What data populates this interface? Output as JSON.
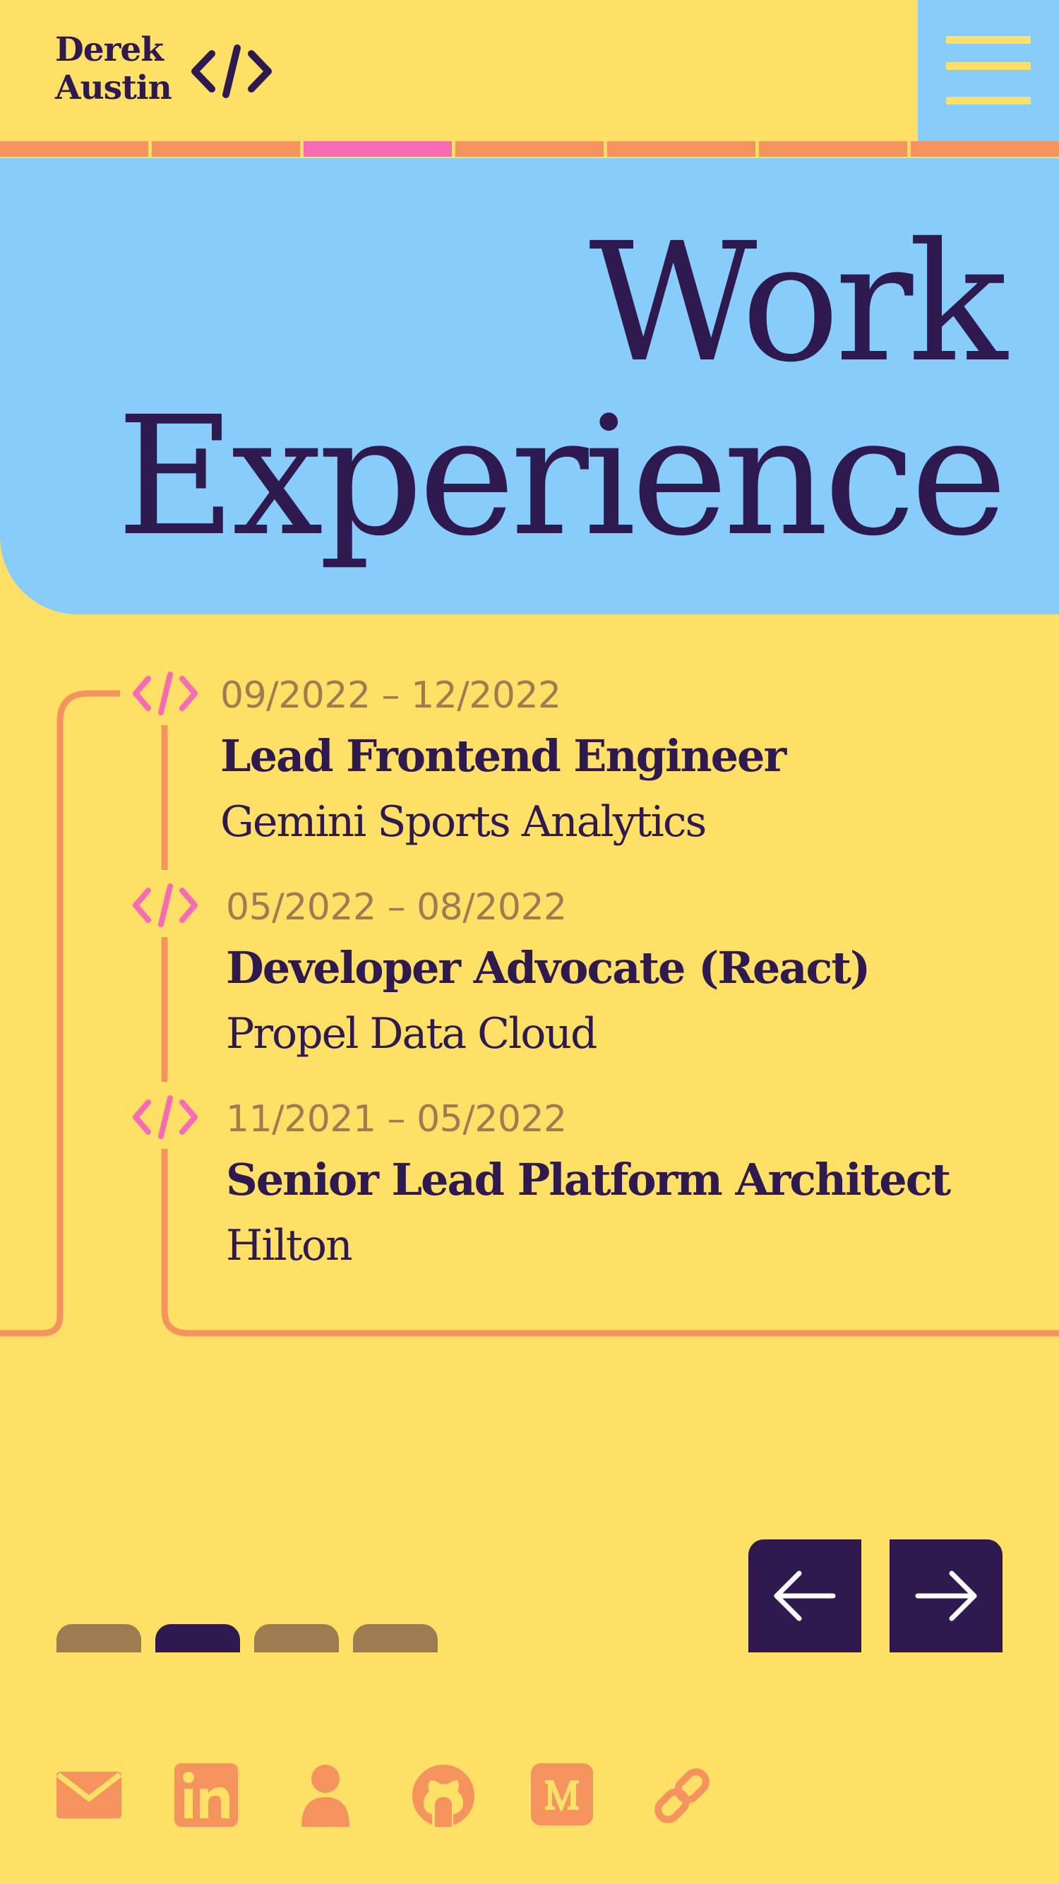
{
  "brand": {
    "first_name": "Derek",
    "last_name": "Austin",
    "logo_icon": "code-brackets-icon"
  },
  "menu": {
    "icon": "hamburger-menu-icon"
  },
  "tabs": {
    "count": 7,
    "active_index": 2
  },
  "hero": {
    "title_line1": "Work",
    "title_line2": "Experience"
  },
  "experience": [
    {
      "dates": "09/2022 – 12/2022",
      "role": "Lead Frontend Engineer",
      "company": "Gemini Sports Analytics",
      "icon": "code-brackets-icon"
    },
    {
      "dates": "05/2022 – 08/2022",
      "role": "Developer Advocate (React)",
      "company": "Propel Data Cloud",
      "icon": "code-brackets-icon"
    },
    {
      "dates": "11/2021 – 05/2022",
      "role": "Senior Lead Platform Architect",
      "company": "Hilton",
      "icon": "code-brackets-icon"
    }
  ],
  "pager": {
    "count": 4,
    "active_index": 1
  },
  "navigation": {
    "prev_icon": "arrow-left-icon",
    "next_icon": "arrow-right-icon"
  },
  "social": [
    {
      "icon": "email-icon"
    },
    {
      "icon": "linkedin-icon"
    },
    {
      "icon": "person-icon"
    },
    {
      "icon": "github-icon"
    },
    {
      "icon": "medium-icon"
    },
    {
      "icon": "link-icon"
    }
  ],
  "colors": {
    "background": "#FFE066",
    "hero_blue": "#88CCFC",
    "ink": "#2E1A4F",
    "accent_orange": "#F4935E",
    "accent_pink": "#F76BB5",
    "muted_brown": "#9C7C50"
  }
}
